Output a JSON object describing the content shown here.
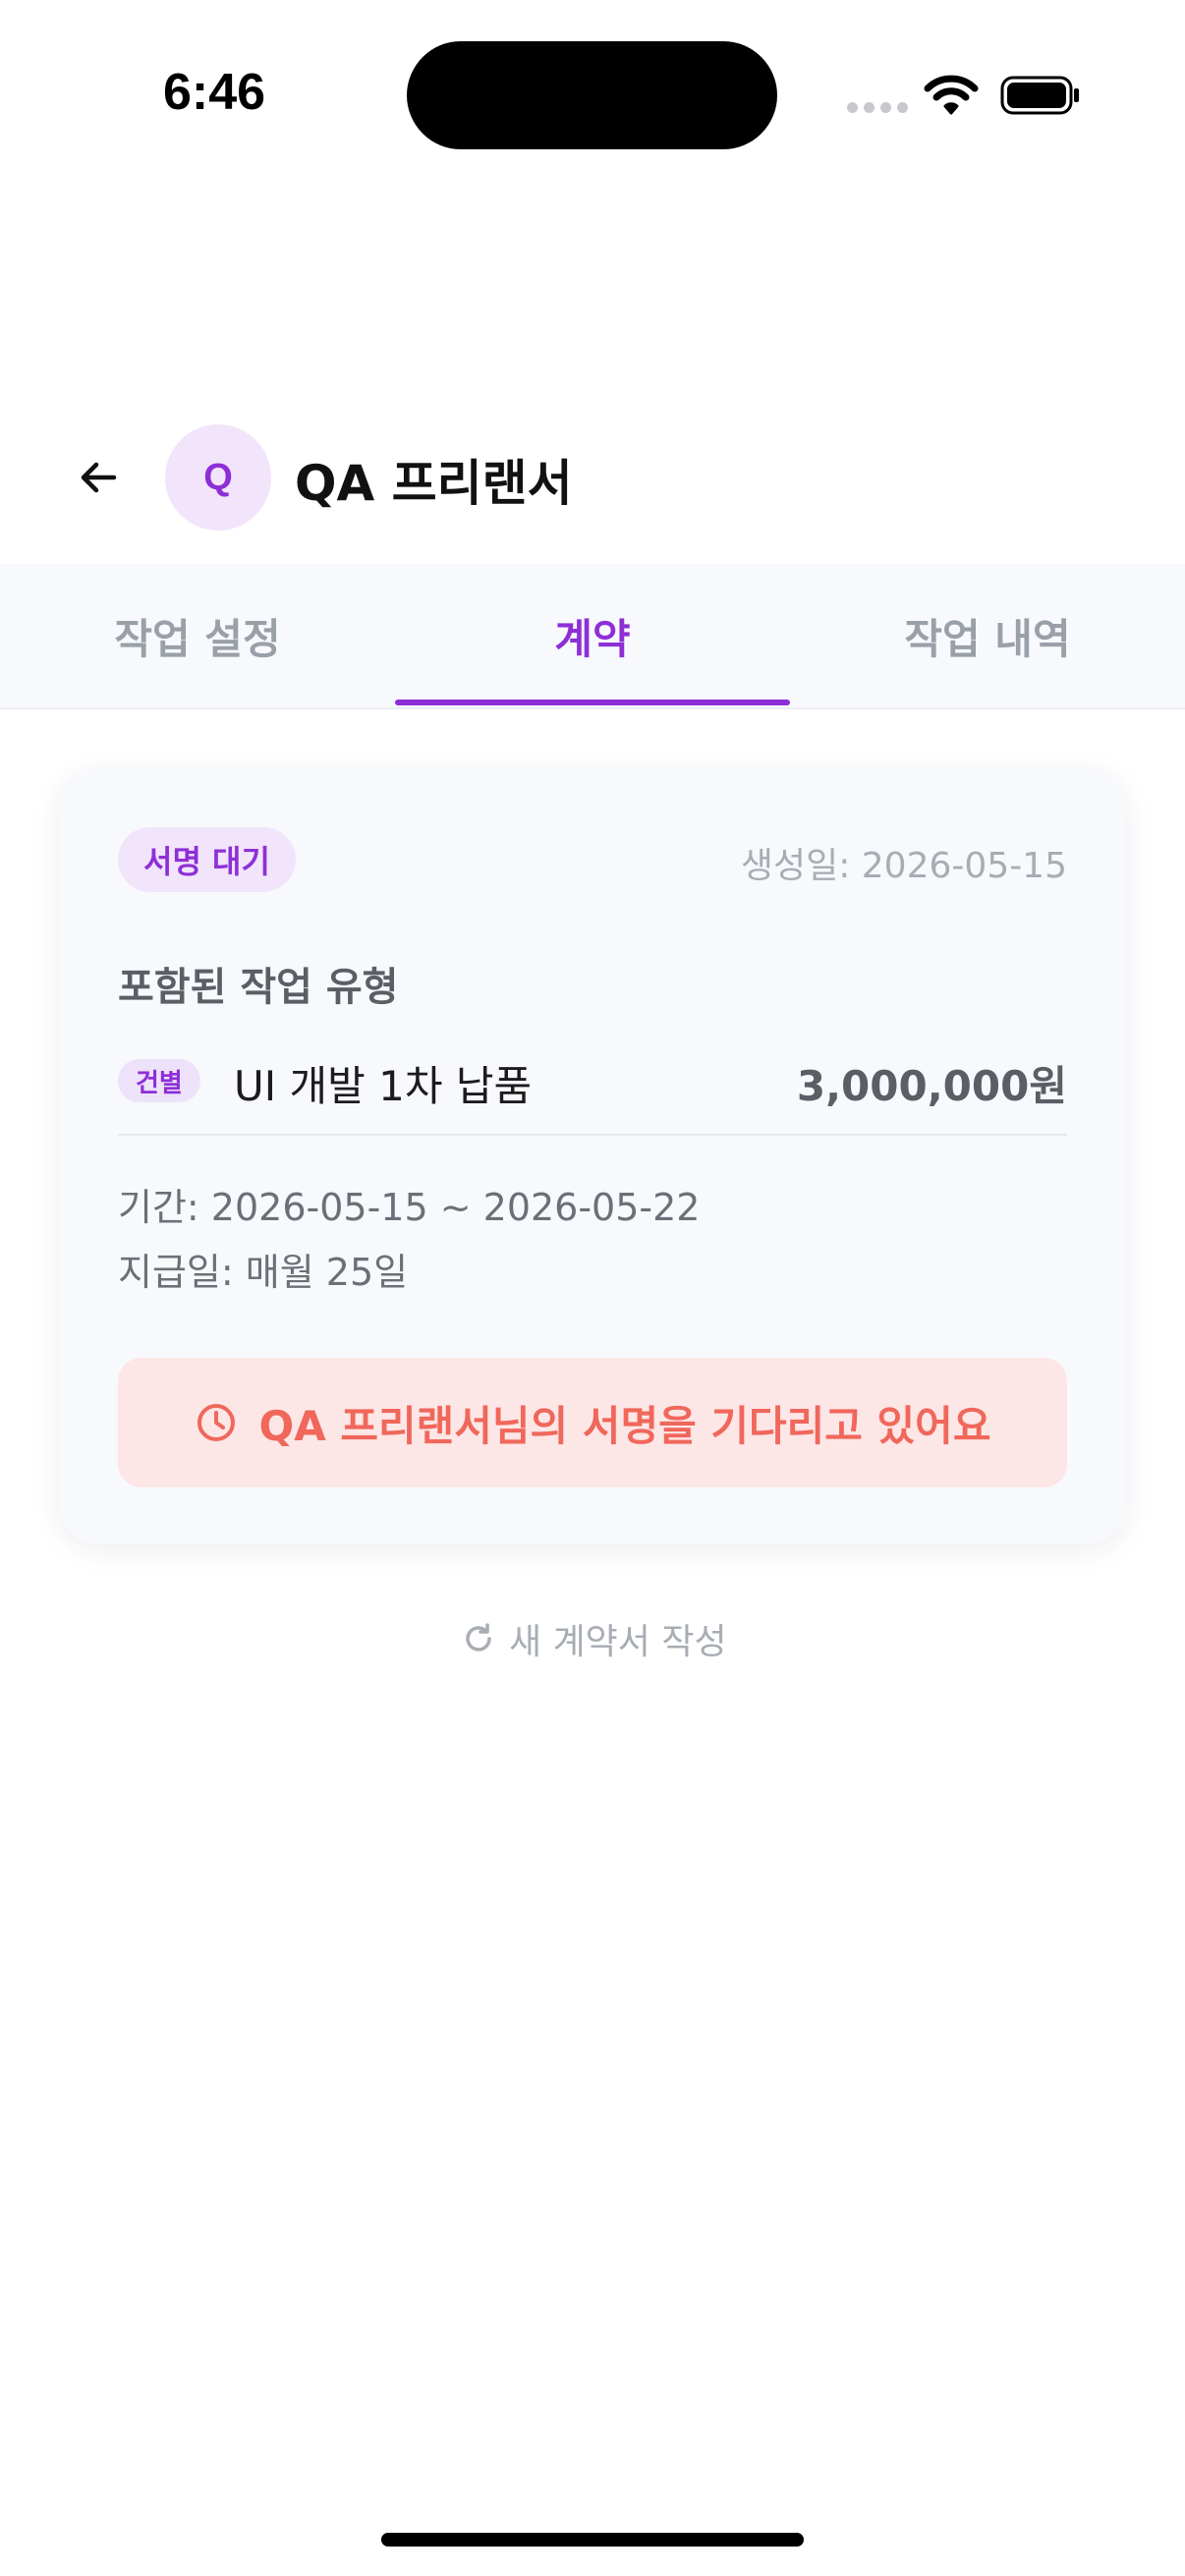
{
  "status_bar": {
    "time": "6:46"
  },
  "header": {
    "avatar_initial": "Q",
    "title": "QA 프리랜서"
  },
  "tabs": [
    {
      "label": "작업 설정",
      "active": false
    },
    {
      "label": "계약",
      "active": true
    },
    {
      "label": "작업 내역",
      "active": false
    }
  ],
  "contract": {
    "status_badge": "서명 대기",
    "created_date": "생성일: 2026-05-15",
    "section_title": "포함된 작업 유형",
    "work_type": {
      "tag": "건별",
      "name": "UI 개발 1차 납품",
      "amount": "3,000,000원"
    },
    "period": "기간: 2026-05-15 ~ 2026-05-22",
    "payment_day": "지급일: 매월 25일",
    "waiting_message": "QA 프리랜서님의 서명을 기다리고 있어요"
  },
  "new_contract_label": "새 계약서 작성",
  "colors": {
    "accent": "#8e2fd6",
    "warning": "#f0675b",
    "warning_bg": "#fde6e6"
  }
}
